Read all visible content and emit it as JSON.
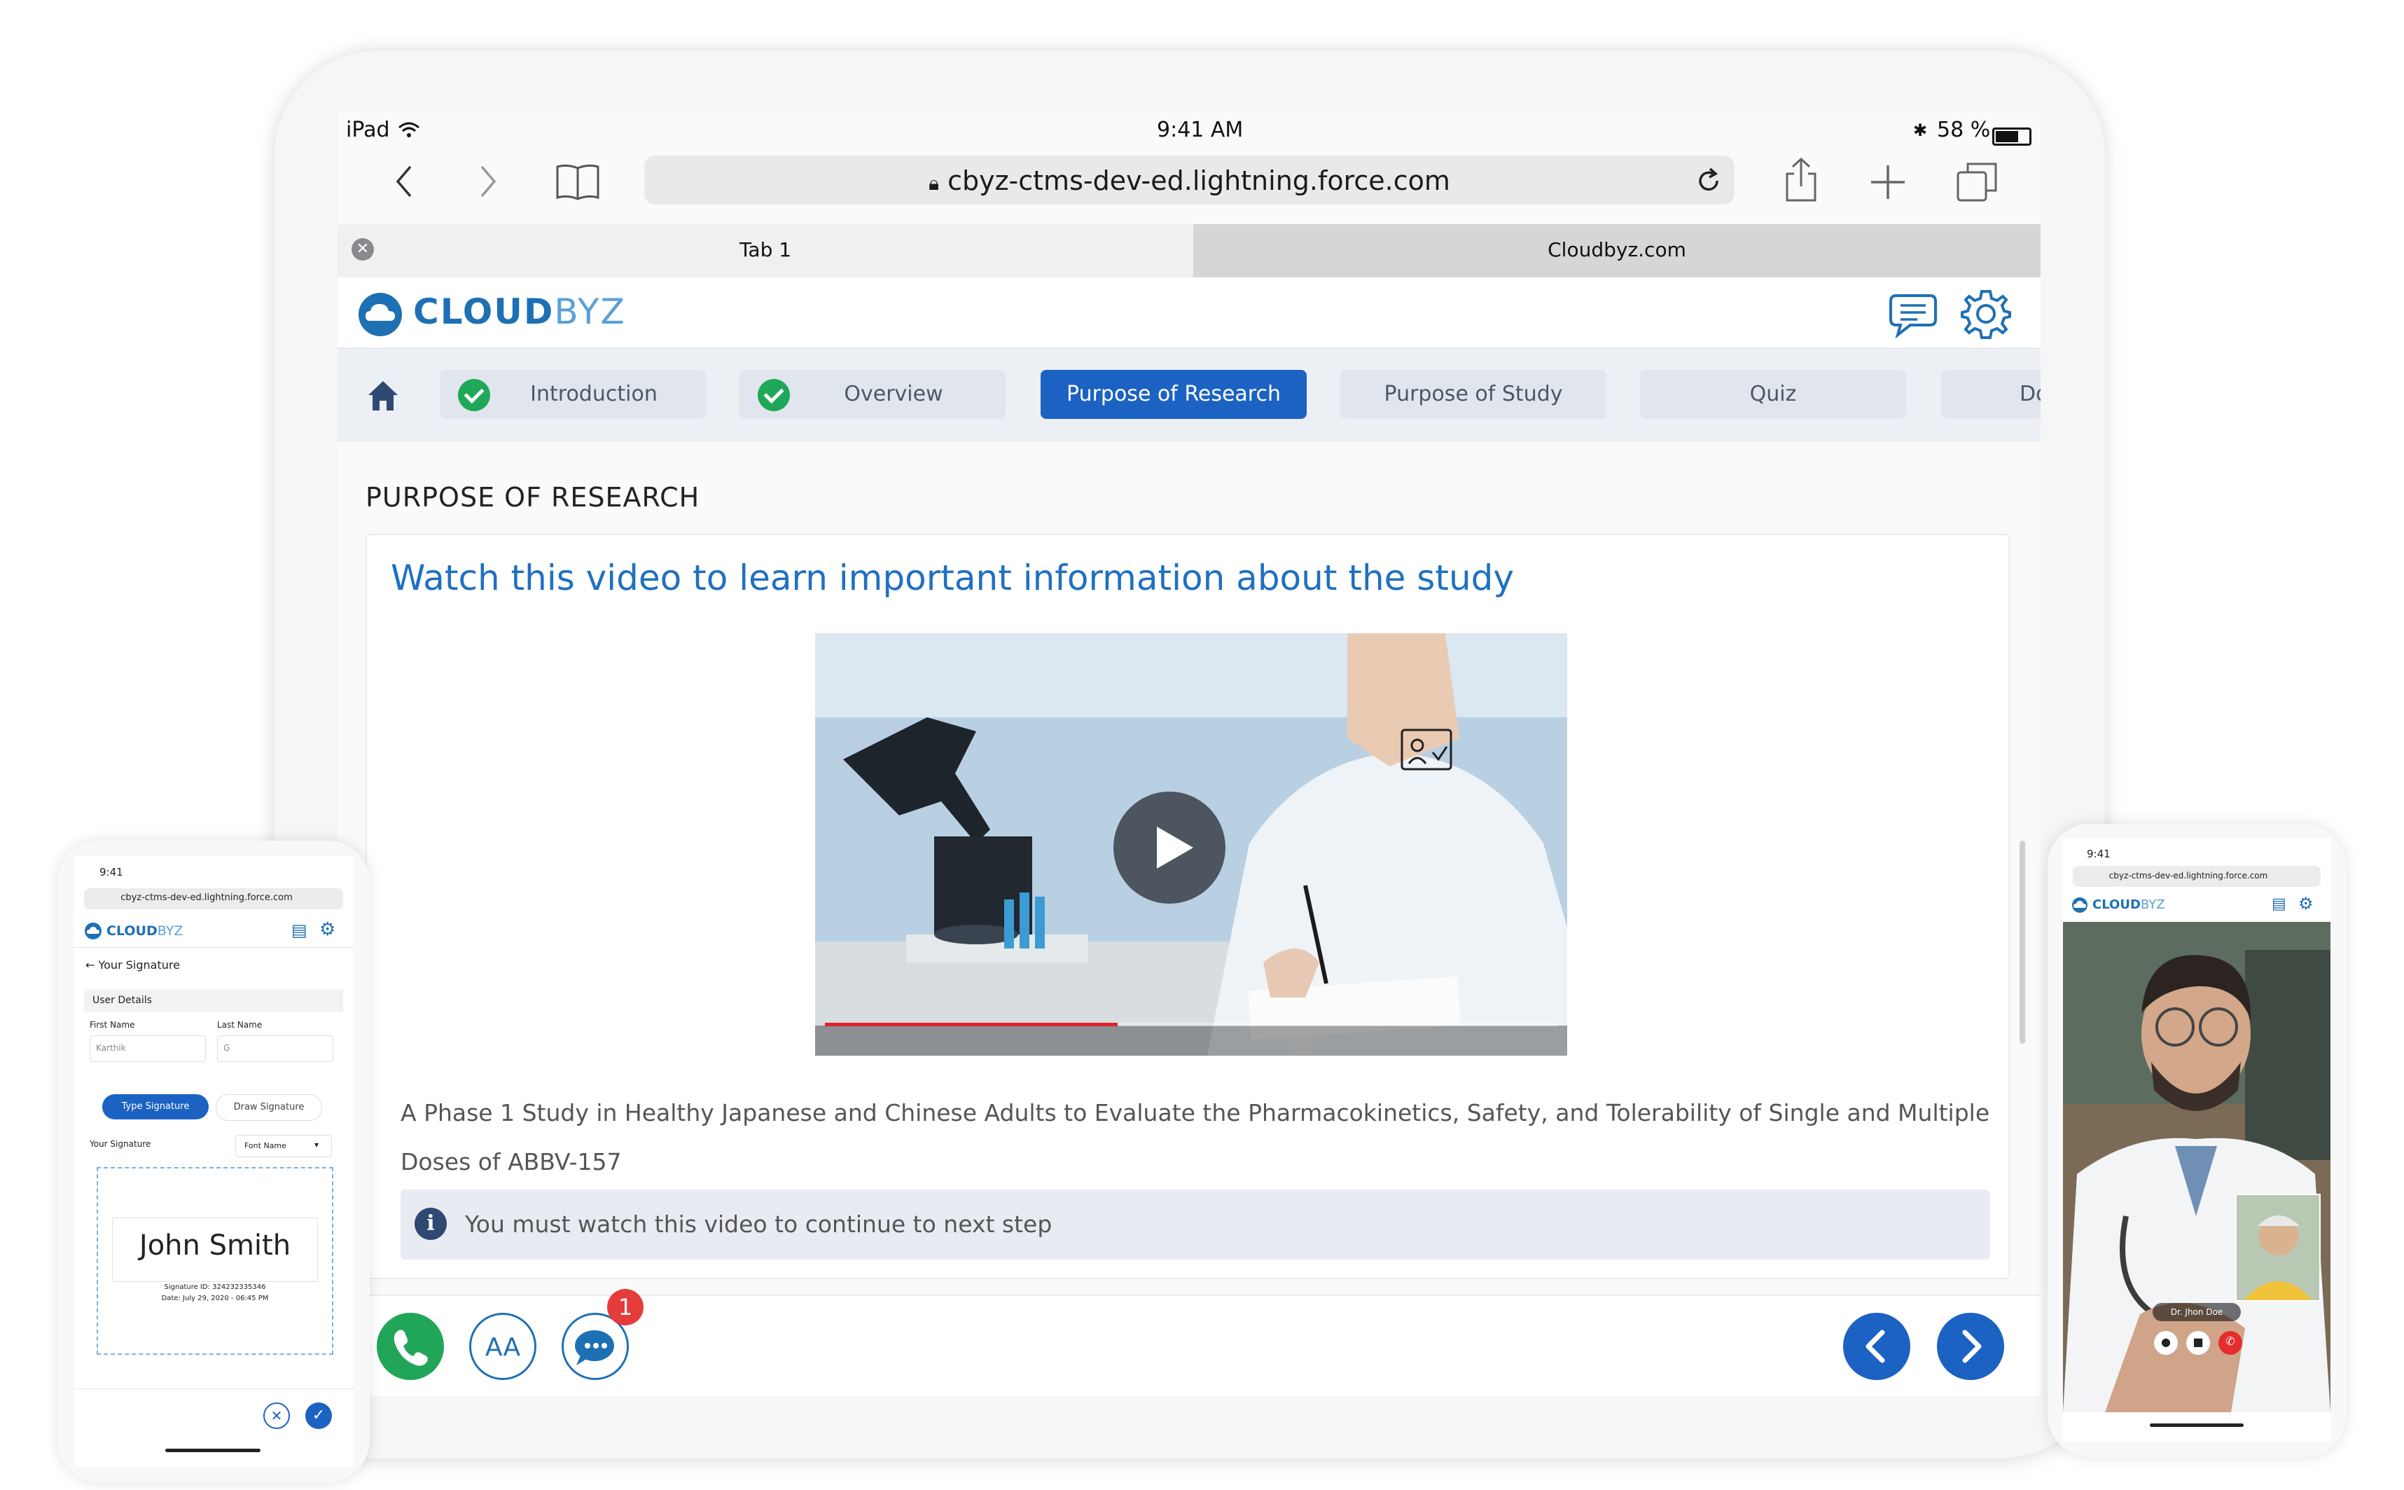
{
  "ipad": {
    "status": {
      "device": "iPad",
      "time": "9:41 AM",
      "battery": "58 %"
    },
    "browser": {
      "url": "cbyz-ctms-dev-ed.lightning.force.com",
      "tabs": [
        {
          "label": "Tab 1"
        },
        {
          "label": "Cloudbyz.com"
        }
      ]
    },
    "app": {
      "logo": {
        "bold": "CLOUD",
        "light": "BYZ"
      },
      "nav": [
        {
          "label": "Introduction",
          "done": true
        },
        {
          "label": "Overview",
          "done": true
        },
        {
          "label": "Purpose of Research",
          "active": true
        },
        {
          "label": "Purpose of Study"
        },
        {
          "label": "Quiz"
        },
        {
          "label": "Do"
        }
      ],
      "page_title": "PURPOSE OF RESEARCH",
      "card_title": "Watch this video to learn important information about the study",
      "description": "A Phase 1 Study in Healthy Japanese and Chinese Adults to Evaluate the Pharmacokinetics, Safety, and Tolerability of Single and Multiple Doses of ABBV-157",
      "notice": "You must watch this video to continue to next step",
      "chat_badge": "1",
      "font_button": "AA",
      "video_progress": 0.4
    }
  },
  "phone_left": {
    "time": "9:41",
    "url": "cbyz-ctms-dev-ed.lightning.force.com",
    "logo": {
      "bold": "CLOUD",
      "light": "BYZ"
    },
    "back_label": "← Your Signature",
    "section": "User Details",
    "first_name_label": "First Name",
    "last_name_label": "Last Name",
    "first_name_value": "Karthik",
    "last_name_value": "G",
    "type_signature": "Type Signature",
    "draw_signature": "Draw Signature",
    "your_signature": "Your Signature",
    "font_select": "Font Name",
    "signature_name": "John Smith",
    "signature_id": "Signature ID: 324232335346",
    "signature_date": "Date: July 29, 2020 - 06:45 PM"
  },
  "phone_right": {
    "time": "9:41",
    "url": "cbyz-ctms-dev-ed.lightning.force.com",
    "logo": {
      "bold": "CLOUD",
      "light": "BYZ"
    },
    "caller": "Dr. Jhon Doe"
  }
}
